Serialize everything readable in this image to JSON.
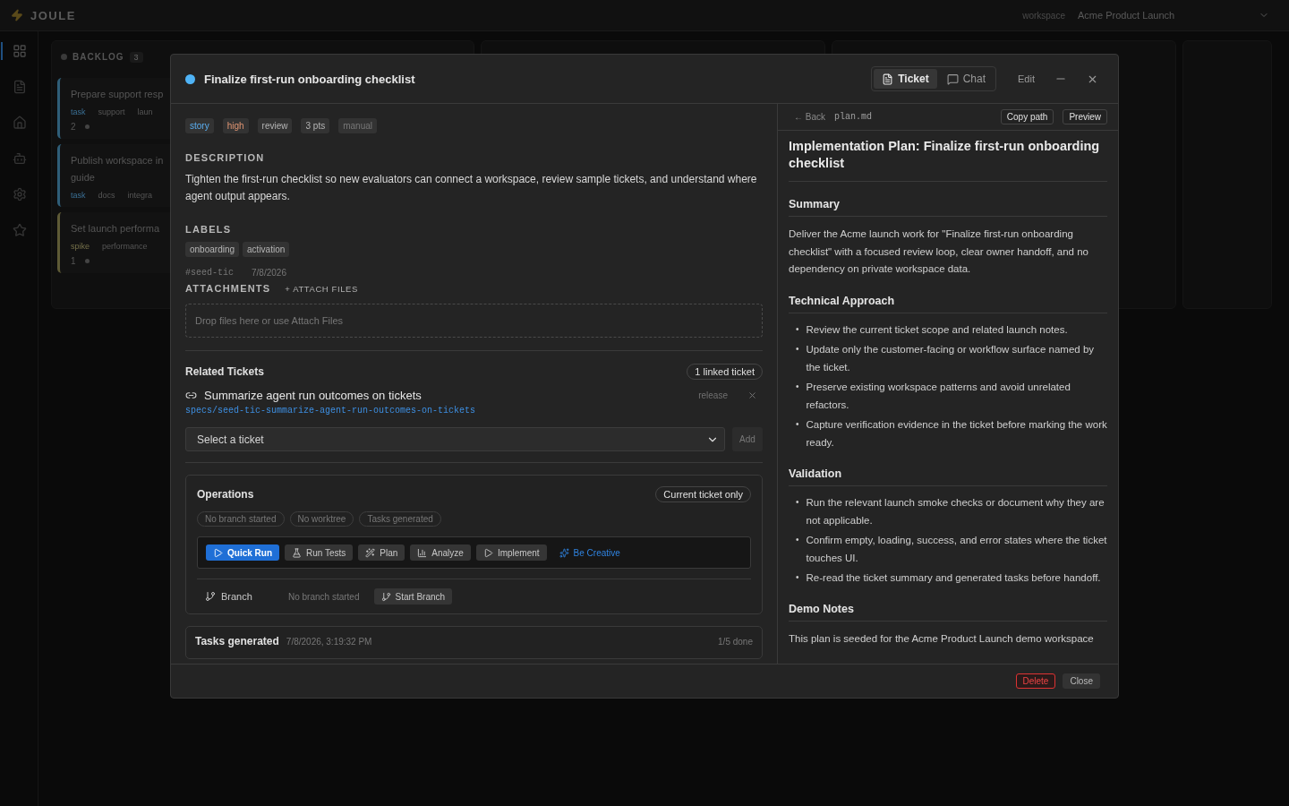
{
  "app": {
    "logo": "JOULE",
    "workspace_label": "workspace",
    "workspace": "Acme Product Launch"
  },
  "sidebar": [
    {
      "kind": "grid",
      "selected": true
    },
    {
      "kind": "doc",
      "selected": false
    },
    {
      "kind": "home",
      "selected": false
    },
    {
      "kind": "bot",
      "selected": false
    },
    {
      "kind": "settings",
      "selected": false
    },
    {
      "kind": "star",
      "selected": false
    }
  ],
  "board": {
    "column": {
      "title": "BACKLOG",
      "count": "3",
      "cards": [
        {
          "title_lines": [
            "Prepare support resp"
          ],
          "color": "#2f5e78",
          "tags": [
            {
              "label": "task",
              "kind": "type"
            },
            {
              "label": "support",
              "kind": "plain"
            },
            {
              "label": "laun",
              "kind": "plain"
            }
          ],
          "count": "2"
        },
        {
          "title_lines": [
            "Publish workspace in",
            "guide"
          ],
          "color": "#2f5e78",
          "tags": [
            {
              "label": "task",
              "kind": "type"
            },
            {
              "label": "docs",
              "kind": "plain"
            },
            {
              "label": "integra",
              "kind": "plain"
            }
          ]
        },
        {
          "title_lines": [
            "Set launch performa"
          ],
          "color": "#5e5a36",
          "tags": [
            {
              "label": "spike",
              "kind": "spike"
            },
            {
              "label": "performance",
              "kind": "plain"
            }
          ],
          "count": "1"
        }
      ]
    }
  },
  "modal": {
    "title": "Finalize first-run onboarding checklist",
    "tabs": [
      {
        "label": "Ticket",
        "selected": true
      },
      {
        "label": "Chat",
        "selected": false
      }
    ],
    "edit": "Edit",
    "tags": [
      {
        "label": "story",
        "kind": "type"
      },
      {
        "label": "high",
        "kind": "priority"
      },
      {
        "label": "review",
        "kind": "plain"
      },
      {
        "label": "3 pts",
        "kind": "plain"
      },
      {
        "label": "manual",
        "kind": "muted"
      }
    ],
    "description_heading": "DESCRIPTION",
    "description": "Tighten the first-run checklist so new evaluators can connect a workspace, review sample tickets, and understand where agent output appears.",
    "labels_heading": "LABELS",
    "labels": [
      "onboarding",
      "activation"
    ],
    "ticket_id": "#seed-tic",
    "date": "7/8/2026",
    "attachments_heading": "ATTACHMENTS",
    "attach_link": "+ ATTACH FILES",
    "drop_hint": "Drop files here or use Attach Files",
    "related": {
      "heading": "Related Tickets",
      "count": "1 linked ticket",
      "items": [
        {
          "title": "Summarize agent run outcomes on tickets",
          "path": "specs/seed-tic-summarize-agent-run-outcomes-on-tickets",
          "tag": "release"
        }
      ],
      "select_placeholder": "Select a ticket",
      "add": "Add"
    },
    "operations": {
      "heading": "Operations",
      "scope": "Current ticket only",
      "statuses": [
        "No branch started",
        "No worktree",
        "Tasks generated"
      ],
      "actions": [
        {
          "label": "Quick Run",
          "kind": "primary"
        },
        {
          "label": "Run Tests",
          "kind": "secondary"
        },
        {
          "label": "Plan",
          "kind": "secondary"
        },
        {
          "label": "Analyze",
          "kind": "secondary"
        },
        {
          "label": "Implement",
          "kind": "secondary"
        },
        {
          "label": "Be Creative",
          "kind": "link"
        }
      ],
      "branch_label": "Branch",
      "branch_status": "No branch started",
      "branch_button": "Start Branch"
    },
    "tasks": {
      "title": "Tasks generated",
      "time": "7/8/2026, 3:19:32 PM",
      "progress": "1/5 done"
    },
    "plan": {
      "back": "← Back",
      "file": "plan.md",
      "copy": "Copy path",
      "preview": "Preview",
      "blocks": [
        {
          "kind": "h1",
          "text": "Implementation Plan: Finalize first-run onboarding checklist"
        },
        {
          "kind": "h2",
          "text": "Summary"
        },
        {
          "kind": "p",
          "text": "Deliver the Acme launch work for \"Finalize first-run onboarding checklist\" with a focused review loop, clear owner handoff, and no dependency on private workspace data."
        },
        {
          "kind": "h2",
          "text": "Technical Approach"
        },
        {
          "kind": "list",
          "items": [
            {
              "marker": "•",
              "text": "Review the current ticket scope and related launch notes."
            },
            {
              "marker": "•",
              "text": "Update only the customer-facing or workflow surface named by the ticket."
            },
            {
              "marker": "•",
              "text": "Preserve existing workspace patterns and avoid unrelated refactors."
            },
            {
              "marker": "•",
              "text": "Capture verification evidence in the ticket before marking the work ready."
            }
          ]
        },
        {
          "kind": "h2",
          "text": "Validation"
        },
        {
          "kind": "list",
          "items": [
            {
              "marker": "•",
              "text": "Run the relevant launch smoke checks or document why they are not applicable."
            },
            {
              "marker": "•",
              "text": "Confirm empty, loading, success, and error states where the ticket touches UI."
            },
            {
              "marker": "•",
              "text": "Re-read the ticket summary and generated tasks before handoff."
            }
          ]
        },
        {
          "kind": "h2",
          "text": "Demo Notes"
        },
        {
          "kind": "p",
          "text": "This plan is seeded for the Acme Product Launch demo workspace"
        }
      ]
    },
    "footer": {
      "delete": "Delete",
      "close": "Close"
    }
  }
}
